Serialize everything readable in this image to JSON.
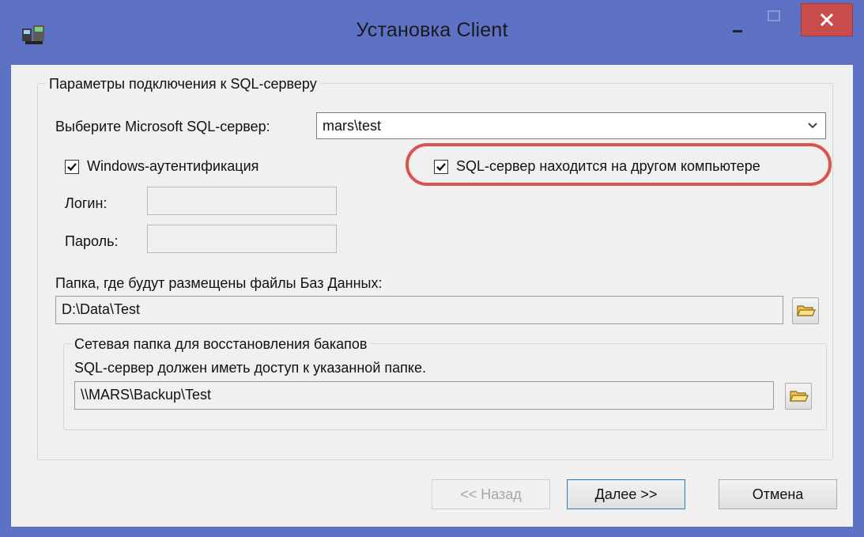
{
  "window": {
    "title": "Установка Client"
  },
  "connection_group": {
    "title": "Параметры подключения к SQL-серверу",
    "server_label": "Выберите Microsoft SQL-сервер:",
    "server_value": "mars\\test",
    "windows_auth_label": "Windows-аутентификация",
    "windows_auth_checked": true,
    "remote_server_label": "SQL-сервер находится на другом компьютере",
    "remote_server_checked": true,
    "login_label": "Логин:",
    "login_value": "",
    "password_label": "Пароль:",
    "password_value": "",
    "db_folder_label": "Папка, где будут размещены файлы Баз Данных:",
    "db_folder_value": "D:\\Data\\Test"
  },
  "backup_group": {
    "title": "Сетевая папка для восстановления бакапов",
    "note": "SQL-сервер должен иметь доступ к указанной папке.",
    "folder_value": "\\\\MARS\\Backup\\Test"
  },
  "buttons": {
    "back": "<< Назад",
    "next": "Далее >>",
    "cancel": "Отмена"
  },
  "colors": {
    "titlebar": "#5d72c4",
    "close_button": "#c94c4c",
    "highlight_ring": "#d9534f"
  }
}
